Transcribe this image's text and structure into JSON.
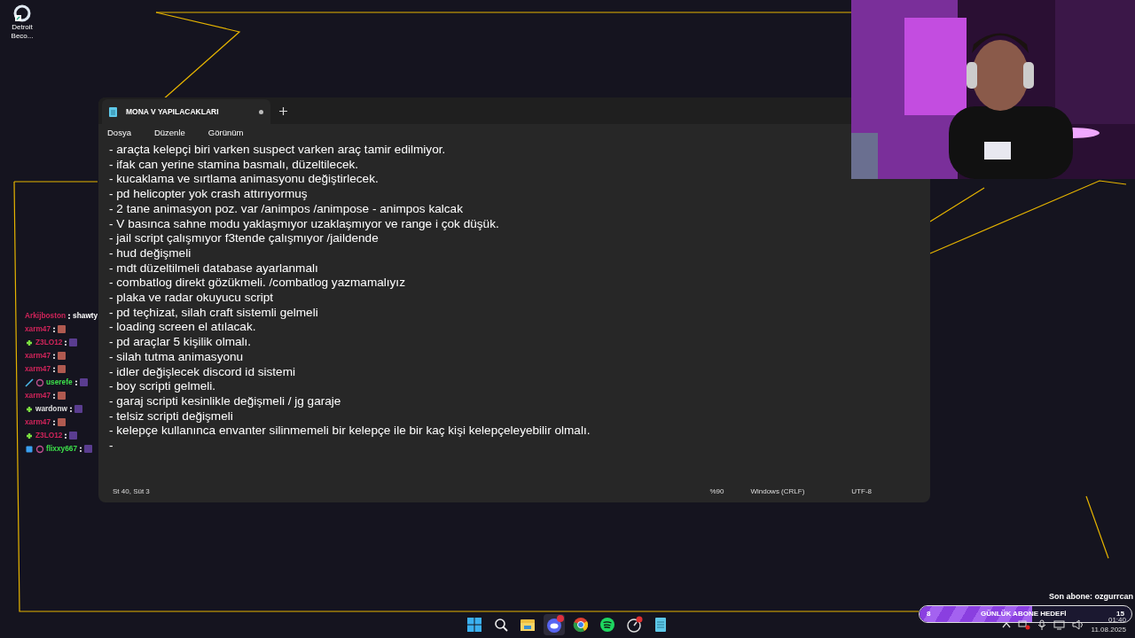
{
  "desktop_icons": [
    {
      "label": "Detroit Beco..."
    }
  ],
  "notepad": {
    "tab": {
      "title": "MONA V YAPILACAKLARI",
      "unsaved": true
    },
    "menu": [
      "Dosya",
      "Düzenle",
      "Görünüm"
    ],
    "lines": [
      "- araçta kelepçi biri varken suspect varken araç tamir edilmiyor.",
      "- ifak can yerine stamina basmalı, düzeltilecek.",
      "- kucaklama ve sırtlama animasyonu değiştirlecek.",
      "- pd helicopter yok crash attırıyormuş",
      "- 2 tane animasyon poz. var /animpos /animpose - animpos kalcak",
      "- V basınca sahne modu yaklaşmıyor uzaklaşmıyor ve range i çok düşük.",
      "- jail script çalışmıyor f3tende çalışmıyor /jaildende",
      "- hud değişmeli",
      "- mdt düzeltilmeli database ayarlanmalı",
      "- combatlog direkt gözükmeli. /combatlog yazmamalıyız",
      "- plaka ve radar okuyucu script",
      "- pd teçhizat, silah craft sistemli gelmeli",
      "- loading screen el atılacak.",
      "- pd araçlar 5 kişilik olmalı.",
      "- silah tutma animasyonu",
      "- idler değişlecek discord id sistemi",
      "- boy scripti gelmeli.",
      "- garaj scripti kesinlikle değişmeli / jg garaje",
      "- telsiz scripti değişmeli",
      "- kelepçe kullanınca envanter silinmemeli bir kelepçe ile bir kaç kişi kelepçeleyebilir olmalı.",
      "-"
    ],
    "status_bar": {
      "position": "St 40, Süt 3",
      "zoom": "%90",
      "line_ending": "Windows (CRLF)",
      "encoding": "UTF-8"
    }
  },
  "chat": [
    {
      "user": "Arkijboston",
      "color": "#d0245a",
      "kind": "plain",
      "text": "shawty"
    },
    {
      "user": "xarm47",
      "color": "#d0245a",
      "kind": "plain"
    },
    {
      "user": "Z3LO12",
      "color": "#d0245a",
      "kind": "plus"
    },
    {
      "user": "xarm47",
      "color": "#d0245a",
      "kind": "plain"
    },
    {
      "user": "xarm47",
      "color": "#d0245a",
      "kind": "plain"
    },
    {
      "user": "userefe",
      "color": "#3ce04a",
      "kind": "sword"
    },
    {
      "user": "xarm47",
      "color": "#d0245a",
      "kind": "plain"
    },
    {
      "user": "wardonw",
      "color": "#e0e0e0",
      "kind": "plus"
    },
    {
      "user": "xarm47",
      "color": "#d0245a",
      "kind": "plain"
    },
    {
      "user": "Z3LO12",
      "color": "#d0245a",
      "kind": "plus"
    },
    {
      "user": "flixxy667",
      "color": "#3ce04a",
      "kind": "cube"
    }
  ],
  "last_subscriber": "Son abone: ozgurrcan",
  "sub_goal": {
    "current": "8",
    "label": "GÜNLÜK ABONE HEDEFİ",
    "target": "15",
    "level": 0.53
  },
  "clock": {
    "time": "01:40",
    "date": "11.08.2025"
  }
}
